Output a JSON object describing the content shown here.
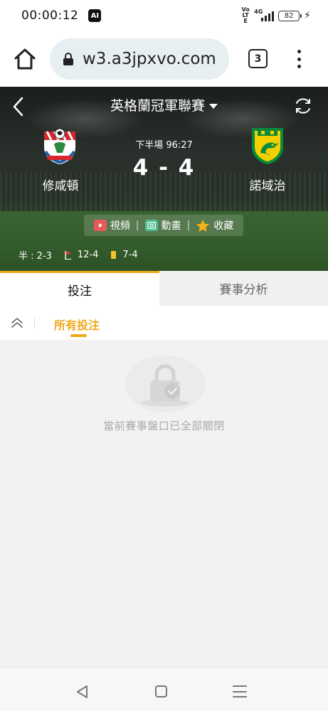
{
  "status_bar": {
    "time": "00:00:12",
    "ai_badge": "AI",
    "volte": "Vo LTE",
    "network": "4G",
    "battery": "82"
  },
  "browser": {
    "url": "w3.a3jpxvo.com",
    "tab_count": "3"
  },
  "match": {
    "league": "英格蘭冠軍聯賽",
    "home_team": "修咸頓",
    "away_team": "諾域治",
    "status": "下半場 96:27",
    "score": "4 - 4",
    "media": {
      "video": "視頻",
      "animation": "動畫",
      "favorite": "收藏"
    },
    "stats": {
      "half": "半 : 2-3",
      "corners": "12-4",
      "yellow_cards": "7-4"
    },
    "colors": {
      "accent": "#f0a81c",
      "home_red": "#d8262f",
      "away_yellow": "#f4d000",
      "away_green": "#0a8a3c"
    }
  },
  "tabs": {
    "bet": "投注",
    "analysis": "賽事分析"
  },
  "sub_tabs": {
    "all_bets": "所有投注"
  },
  "empty_state": {
    "message": "當前賽事盤口已全部關閉"
  },
  "icons": {
    "home": "home-icon",
    "lock": "lock-icon",
    "back": "chevron-left-icon",
    "refresh": "refresh-icon",
    "video": "play-icon",
    "animation": "pitch-icon",
    "favorite": "star-icon",
    "corner": "corner-flag-icon",
    "yellow_card": "yellow-card-icon"
  }
}
